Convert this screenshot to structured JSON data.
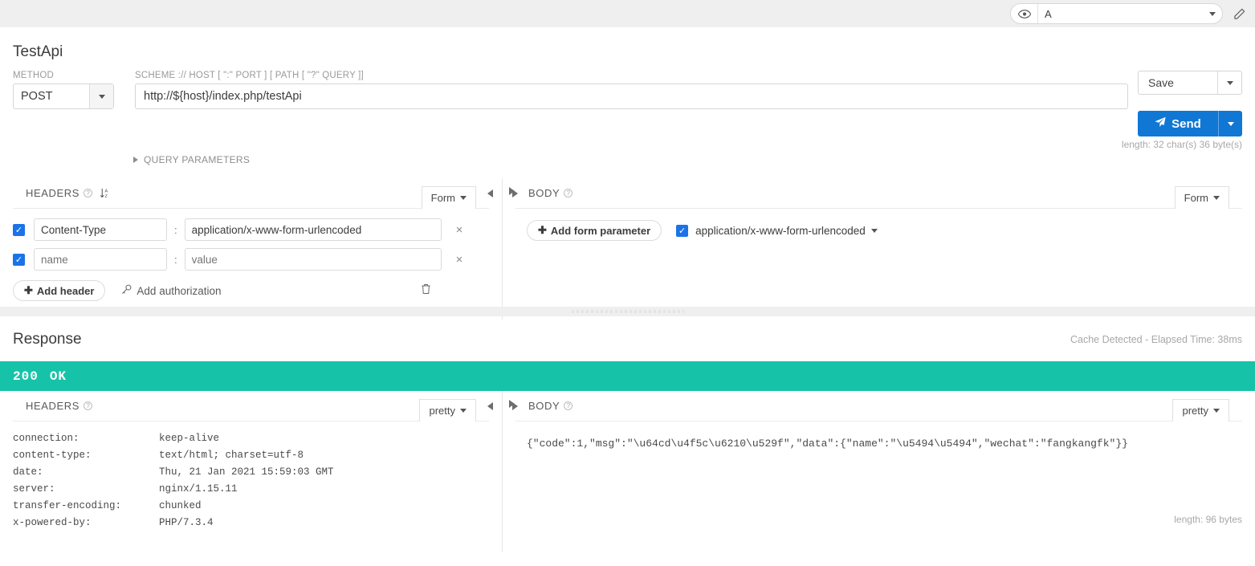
{
  "topbar": {
    "eye_icon": "eye-icon",
    "environment_value": "A",
    "pencil_icon": "pencil-icon"
  },
  "request": {
    "title": "TestApi",
    "method_label": "METHOD",
    "method_value": "POST",
    "url_label": "SCHEME :// HOST [ \":\" PORT ] [ PATH [ \"?\" QUERY ]]",
    "url_value": "http://${host}/index.php/testApi",
    "save_label": "Save",
    "send_label": "Send",
    "send_icon": "paper-plane-icon",
    "length_note": "length: 32 char(s) 36 byte(s)",
    "query_parameters_label": "QUERY PARAMETERS"
  },
  "headers_pane": {
    "title": "HEADERS",
    "help_icon": "question-mark-icon",
    "sort_icon": "sort-alpha-icon",
    "format_value": "Form",
    "rows": [
      {
        "checked": true,
        "name": "Content-Type",
        "name_placeholder": "name",
        "value": "application/x-www-form-urlencoded",
        "value_placeholder": "value",
        "remove": "×"
      },
      {
        "checked": true,
        "name": "",
        "name_placeholder": "name",
        "value": "",
        "value_placeholder": "value",
        "remove": "×"
      }
    ],
    "add_header_label": "Add header",
    "add_authorization_label": "Add authorization",
    "auth_icon": "key-icon",
    "delete_icon": "trash-icon"
  },
  "body_pane": {
    "title": "BODY",
    "help_icon": "question-mark-icon",
    "format_value": "Form",
    "add_form_parameter_label": "Add form parameter",
    "content_type_value": "application/x-www-form-urlencoded",
    "content_type_checked": true
  },
  "response": {
    "title": "Response",
    "cache_note": "Cache Detected - Elapsed Time: 38ms",
    "status_code": "200",
    "status_text": "OK",
    "headers_pane": {
      "title": "HEADERS",
      "help_icon": "question-mark-icon",
      "format_value": "pretty",
      "rows": [
        {
          "key": "connection:",
          "value": "keep-alive"
        },
        {
          "key": "content-type:",
          "value": "text/html; charset=utf-8"
        },
        {
          "key": "date:",
          "value": "Thu, 21 Jan 2021 15:59:03 GMT"
        },
        {
          "key": "server:",
          "value": "nginx/1.15.11"
        },
        {
          "key": "transfer-encoding:",
          "value": "chunked"
        },
        {
          "key": "x-powered-by:",
          "value": "PHP/7.3.4"
        }
      ]
    },
    "body_pane": {
      "title": "BODY",
      "help_icon": "question-mark-icon",
      "format_value": "pretty",
      "content": "{\"code\":1,\"msg\":\"\\u64cd\\u4f5c\\u6210\\u529f\",\"data\":{\"name\":\"\\u5494\\u5494\",\"wechat\":\"fangkangfk\"}}",
      "length_note": "length: 96 bytes"
    }
  },
  "colors": {
    "accent_blue": "#1077d4",
    "status_green": "#17c3a8",
    "checkbox_blue": "#1a73e8"
  }
}
